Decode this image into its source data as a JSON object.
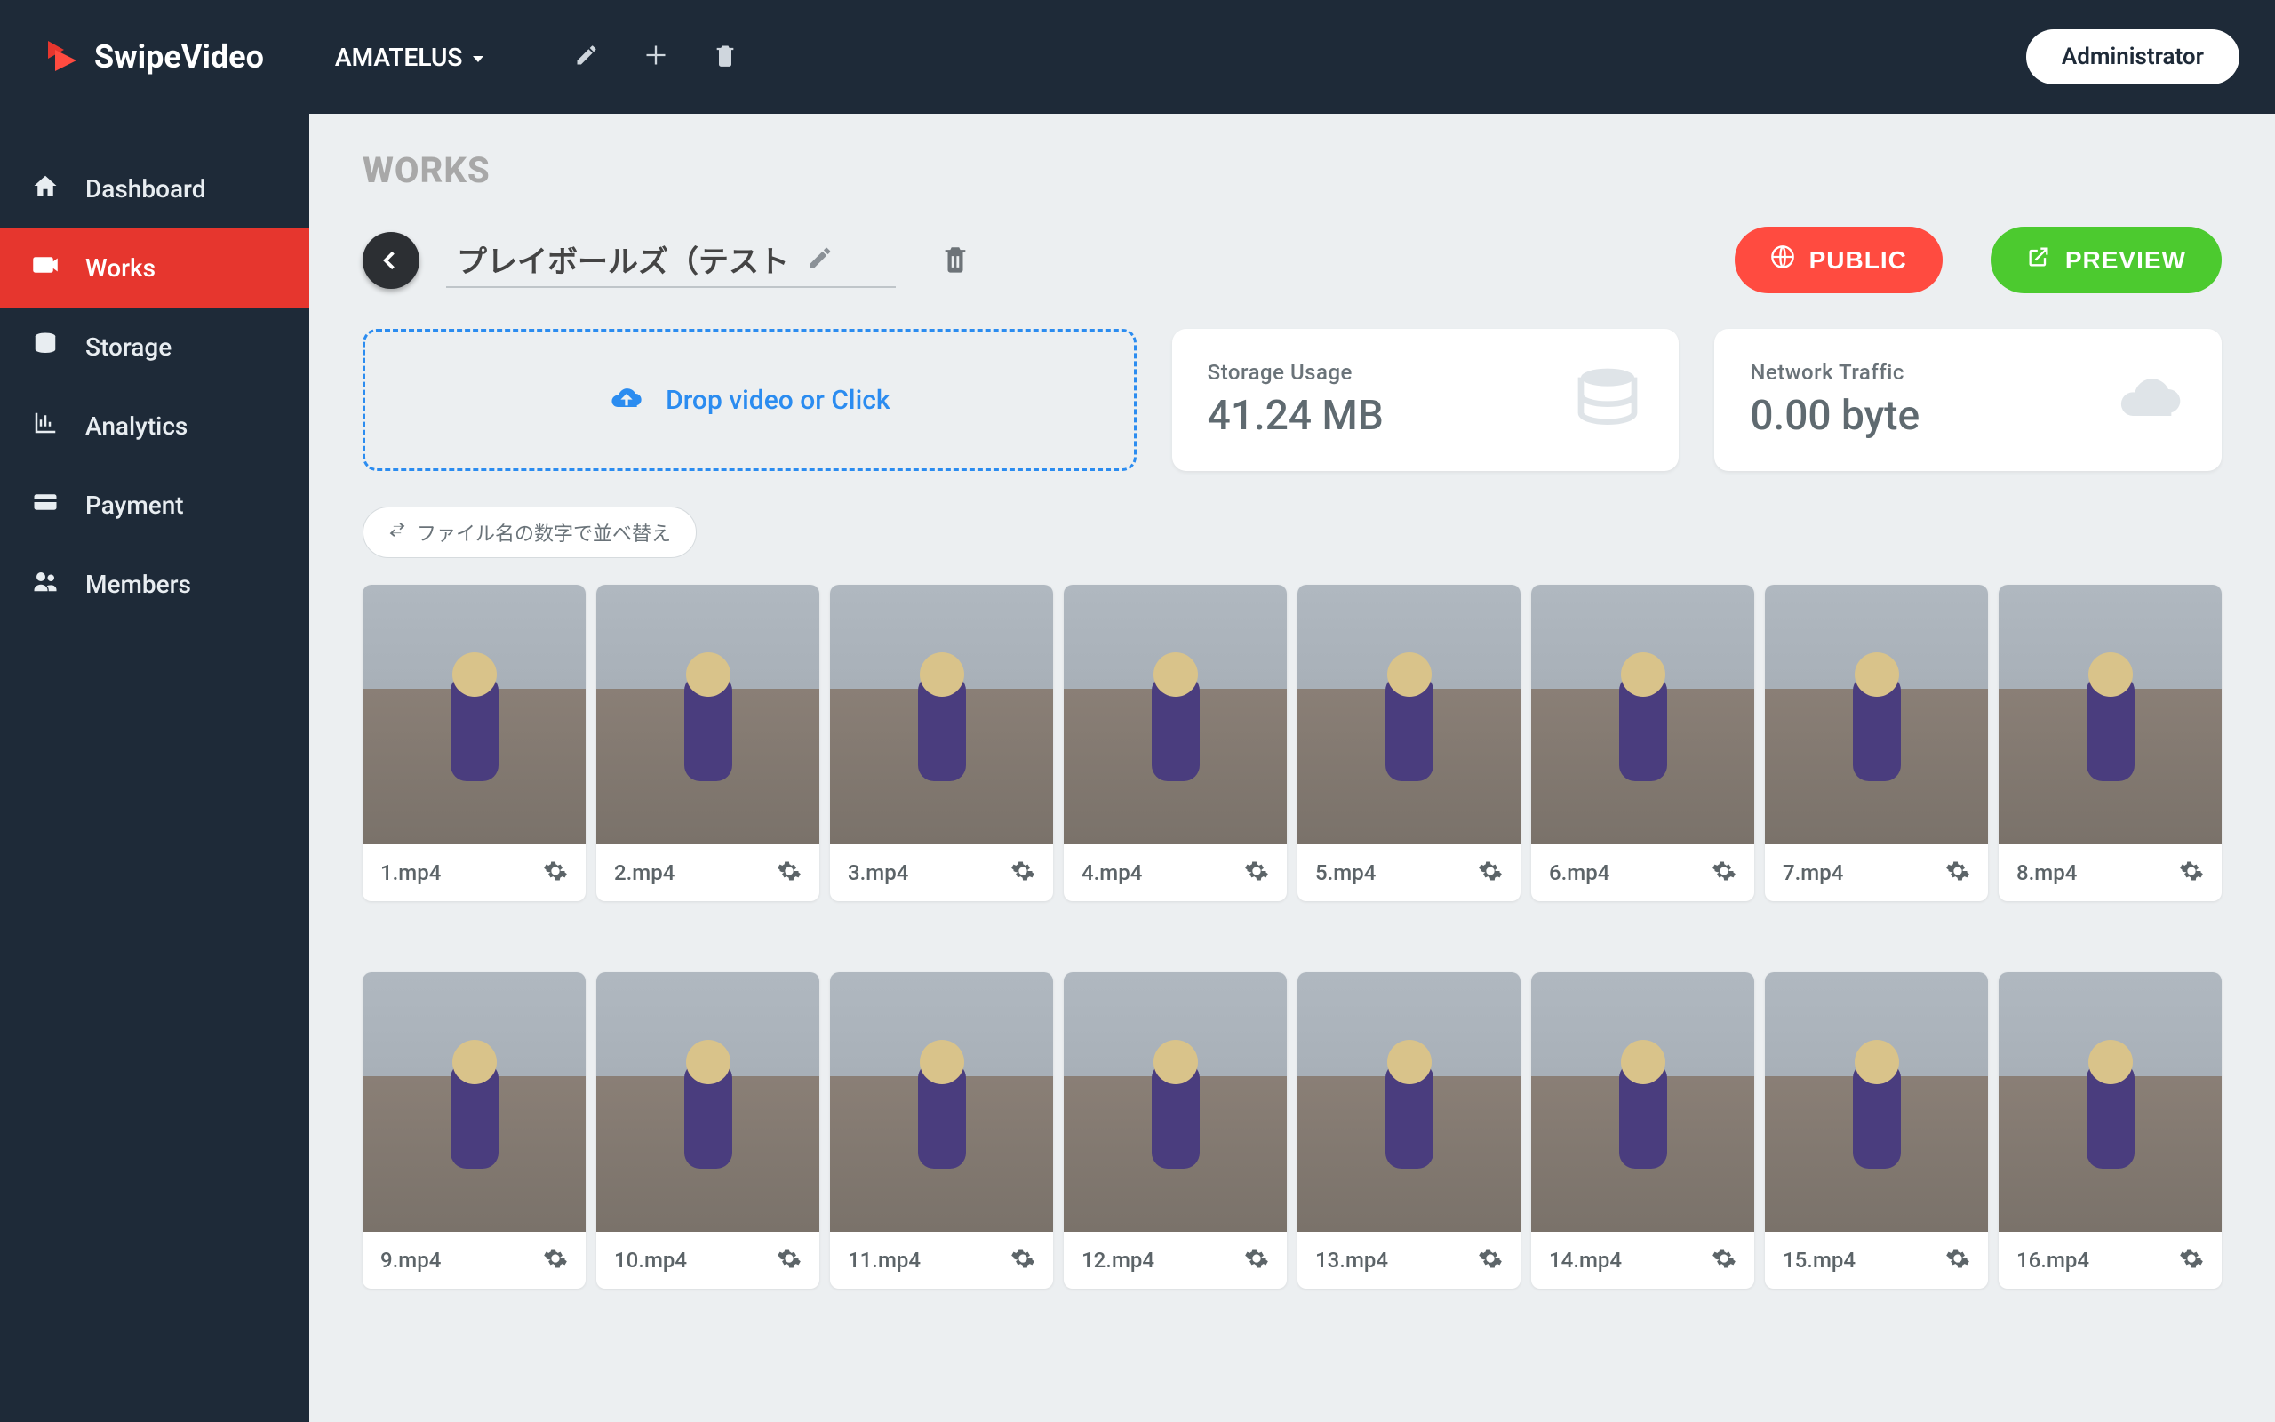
{
  "header": {
    "brand": "SwipeVideo",
    "org": "AMATELUS",
    "admin_label": "Administrator"
  },
  "sidebar": {
    "items": [
      {
        "label": "Dashboard",
        "icon": "home-icon",
        "active": false
      },
      {
        "label": "Works",
        "icon": "video-icon",
        "active": true
      },
      {
        "label": "Storage",
        "icon": "database-icon",
        "active": false
      },
      {
        "label": "Analytics",
        "icon": "chart-icon",
        "active": false
      },
      {
        "label": "Payment",
        "icon": "card-icon",
        "active": false
      },
      {
        "label": "Members",
        "icon": "people-icon",
        "active": false
      }
    ]
  },
  "main": {
    "page_title": "WORKS",
    "work_title": "プレイボールズ（テスト",
    "public_label": "PUBLIC",
    "preview_label": "PREVIEW",
    "dropzone_text": "Drop video or Click",
    "storage": {
      "label": "Storage Usage",
      "value": "41.24 MB"
    },
    "network": {
      "label": "Network Traffic",
      "value": "0.00 byte"
    },
    "sort_label": "ファイル名の数字で並べ替え",
    "files_row1": [
      "1.mp4",
      "2.mp4",
      "3.mp4",
      "4.mp4",
      "5.mp4",
      "6.mp4",
      "7.mp4",
      "8.mp4"
    ],
    "files_row2": [
      "9.mp4",
      "10.mp4",
      "11.mp4",
      "12.mp4",
      "13.mp4",
      "14.mp4",
      "15.mp4",
      "16.mp4"
    ]
  }
}
